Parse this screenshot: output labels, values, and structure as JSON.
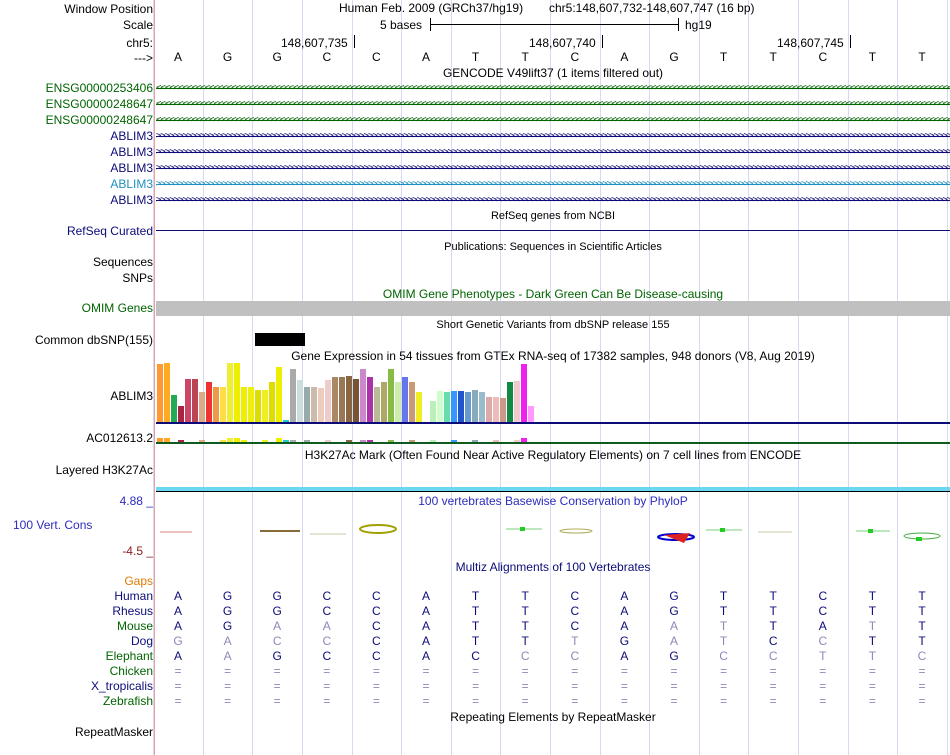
{
  "header": {
    "window_position_label": "Window Position",
    "assembly_text": "Human Feb. 2009 (GRCh37/hg19)",
    "position_text": "chr5:148,607,732-148,607,747 (16 bp)",
    "scale_label": "Scale",
    "scale_value": "5 bases",
    "scale_db": "hg19",
    "chr_label": "chr5:",
    "coord_1": "148,607,735",
    "coord_2": "148,607,740",
    "coord_3": "148,607,745",
    "strand_label": "--->"
  },
  "bases": [
    "A",
    "G",
    "G",
    "C",
    "C",
    "A",
    "T",
    "T",
    "C",
    "A",
    "G",
    "T",
    "T",
    "C",
    "T",
    "T"
  ],
  "gencode": {
    "title": "GENCODE V49lift37 (1 items filtered out)",
    "tracks": [
      {
        "label": "ENSG00000253406",
        "color": "#006400",
        "dir": "<"
      },
      {
        "label": "ENSG00000248647",
        "color": "#006400",
        "dir": "<"
      },
      {
        "label": "ENSG00000248647",
        "color": "#006400",
        "dir": "<"
      },
      {
        "label": "ABLIM3",
        "color": "#0c0c78",
        "dir": ">"
      },
      {
        "label": "ABLIM3",
        "color": "#0c0c78",
        "dir": ">"
      },
      {
        "label": "ABLIM3",
        "color": "#0c0c78",
        "dir": ">"
      },
      {
        "label": "ABLIM3",
        "color": "#1e8fbf",
        "dir": ">"
      },
      {
        "label": "ABLIM3",
        "color": "#0c0c78",
        "dir": ">"
      }
    ]
  },
  "refseq": {
    "title": "RefSeq genes from NCBI",
    "label": "RefSeq Curated"
  },
  "publications": {
    "title": "Publications: Sequences in Scientific Articles",
    "labels": [
      "Sequences",
      "SNPs"
    ]
  },
  "omim": {
    "title": "OMIM Gene Phenotypes - Dark Green Can Be Disease-causing",
    "label": "OMIM Genes",
    "title_color": "#006400"
  },
  "dbsnp": {
    "title": "Short Genetic Variants from dbSNP release 155",
    "label": "Common dbSNP(155)"
  },
  "gtex": {
    "title": "Gene Expression in 54 tissues from GTEx RNA-seq of 17382 samples, 948 donors (V8, Aug 2019)",
    "gene1": "ABLIM3",
    "gene2": "AC012613.2",
    "levels": [
      0.98,
      1.0,
      0.45,
      0.27,
      0.73,
      0.73,
      0.51,
      0.67,
      0.6,
      0.6,
      1.0,
      1.0,
      0.6,
      0.6,
      0.55,
      0.55,
      0.67,
      0.93,
      0.04,
      0.9,
      0.71,
      0.6,
      0.6,
      0.58,
      0.71,
      0.76,
      0.76,
      0.78,
      0.73,
      0.9,
      0.76,
      0.6,
      0.67,
      0.89,
      0.67,
      0.76,
      0.67,
      0.51,
      0.95,
      0.36,
      0.53,
      0.51,
      0.53,
      0.53,
      0.51,
      0.55,
      0.51,
      0.42,
      0.42,
      0.4,
      0.67,
      0.69,
      0.98,
      0.27
    ],
    "colors": [
      "#ff9933",
      "#ffaa22",
      "#22aa55",
      "#aa2244",
      "#cc4466",
      "#bb4455",
      "#ddaa88",
      "#ee3333",
      "#ee9944",
      "#ffdd44",
      "#eeee33",
      "#eeee00",
      "#eeee00",
      "#eeee11",
      "#dddd00",
      "#eeee22",
      "#dddd00",
      "#eeee00",
      "#22cccc",
      "#aaaaaa",
      "#ccdddd",
      "#99aaaa",
      "#ccbbaa",
      "#eeccbb",
      "#eecccc",
      "#aa8866",
      "#997755",
      "#886644",
      "#775533",
      "#cc88cc",
      "#aa33aa",
      "#bbbb99",
      "#aaaa66",
      "#88bb44",
      "#cceeaa",
      "#6677ee",
      "#cc9977",
      "#eeee22",
      "#ffffff",
      "#bbeebb",
      "#ccffcc",
      "#66ddaa",
      "#3399ff",
      "#2255cc",
      "#6699cc",
      "#88aabb",
      "#99bbcc",
      "#ddaaaa",
      "#eebbbb",
      "#cc9988",
      "#118844",
      "#eecccc",
      "#ee22ee",
      "#ff99ff"
    ]
  },
  "h3k27ac": {
    "title": "H3K27Ac Mark (Often Found Near Active Regulatory Elements) on 7 cell lines from ENCODE",
    "label": "Layered H3K27Ac"
  },
  "conservation": {
    "title": "100 vertebrates Basewise Conservation by PhyloP",
    "label": "100 Vert. Cons",
    "max": "4.88 _",
    "min": "-4.5 _",
    "title_color": "#2c2cbf"
  },
  "multiz": {
    "title": "Multiz Alignments of 100 Vertebrates",
    "gaps_label": "Gaps",
    "species": [
      {
        "name": "Human",
        "color": "#0c0c78",
        "seq": "AGGCCATTCAGTTCTT"
      },
      {
        "name": "Rhesus",
        "color": "#0c0c78",
        "seq": "AGGCCATTCAGTTCTT"
      },
      {
        "name": "Mouse",
        "color": "#006400",
        "seq": "AGAACATTCAATTATT"
      },
      {
        "name": "Dog",
        "color": "#0c0c78",
        "seq": "GACCCATTTGATCCTT"
      },
      {
        "name": "Elephant",
        "color": "#006400",
        "seq": "AAGCCACCCAGCCTTC"
      },
      {
        "name": "Chicken",
        "color": "#006400",
        "seq": "================"
      },
      {
        "name": "X_tropicalis",
        "color": "#0c0c78",
        "seq": "================"
      },
      {
        "name": "Zebrafish",
        "color": "#006400",
        "seq": "================"
      }
    ],
    "faded_mask": [
      "0000000000000000",
      "0000000000000000",
      "0011000000110010",
      "1111000010110100",
      "0100000110011111",
      "1111111111111111",
      "1111111111111111",
      "1111111111111111"
    ]
  },
  "repeatmasker": {
    "title": "Repeating Elements by RepeatMasker",
    "label": "RepeatMasker"
  },
  "colors": {
    "border": "#e8a0a0",
    "dark_navy": "#0c0c78",
    "omim_bar": "#c0c0c0",
    "h3k27ac_bar": "#6bd7f0"
  }
}
